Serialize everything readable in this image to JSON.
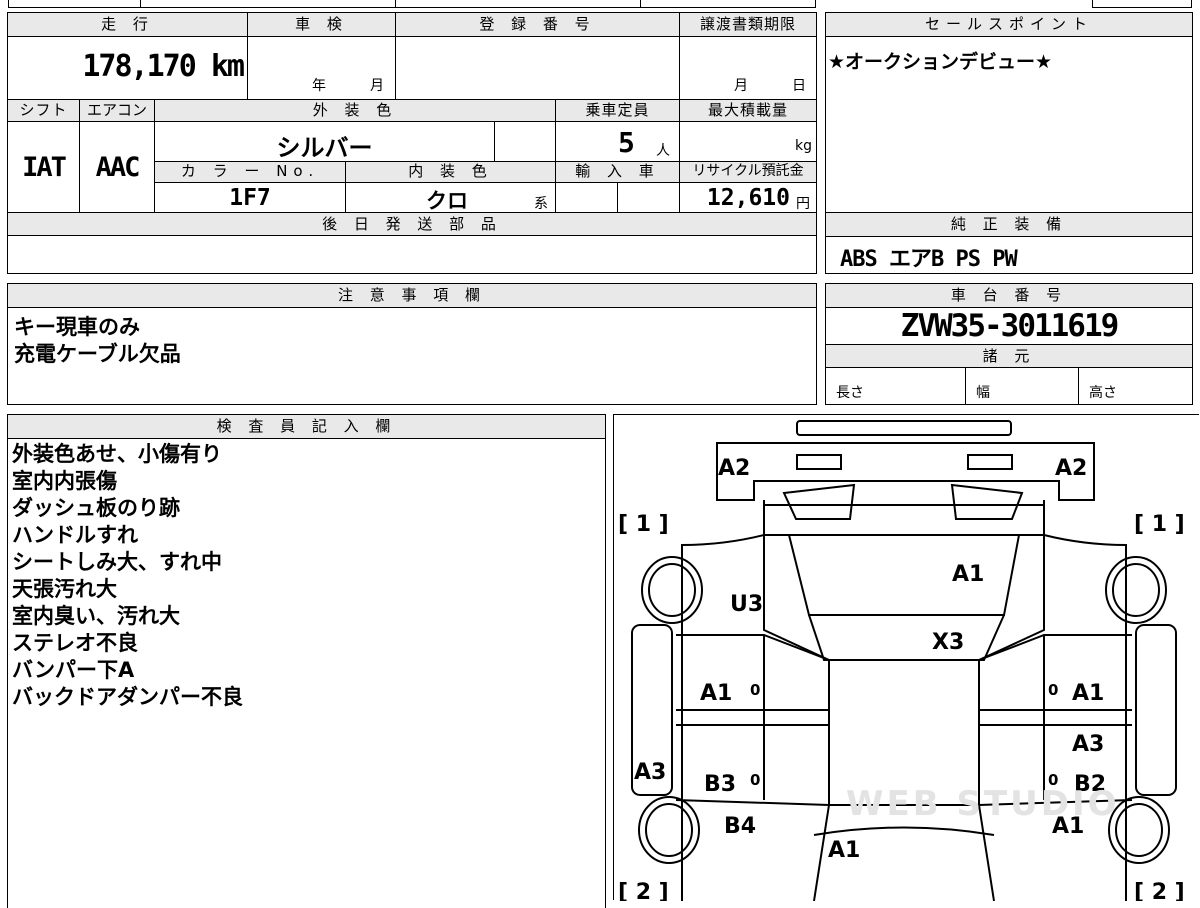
{
  "vehicle": {
    "headers": {
      "mileage": "走 行",
      "inspection": "車 検",
      "registration": "登 録 番 号",
      "transfer_deadline": "譲渡書類期限",
      "shift": "シフト",
      "aircon": "エアコン",
      "exterior_color": "外 装 色",
      "capacity": "乗車定員",
      "max_load": "最大積載量",
      "color_no": "カ ラ ー No.",
      "interior_color": "内 装 色",
      "import": "輸 入 車",
      "recycle_fee": "リサイクル預託金",
      "later_parts": "後 日 発 送 部 品"
    },
    "mileage": "178,170 km",
    "inspection_year_label": "年",
    "inspection_month_label": "月",
    "transfer_month_label": "月",
    "transfer_day_label": "日",
    "shift": "IAT",
    "aircon": "AAC",
    "exterior_color": "シルバー",
    "capacity": "5",
    "capacity_unit": "人",
    "max_load_unit": "kg",
    "color_no": "1F7",
    "interior_color": "クロ",
    "interior_suffix": "系",
    "recycle_fee": "12,610",
    "recycle_unit": "円"
  },
  "sales_points": {
    "header": "セールスポイント",
    "text": "★オークションデビュー★"
  },
  "equipment": {
    "header": "純 正 装 備",
    "text": "ABS エアB PS PW"
  },
  "notes": {
    "header": "注 意 事 項 欄",
    "lines": [
      "キー現車のみ",
      "充電ケーブル欠品"
    ]
  },
  "chassis": {
    "header": "車 台 番 号",
    "number": "ZVW35-3011619",
    "specs_header": "諸 元",
    "length_label": "長さ",
    "width_label": "幅",
    "height_label": "高さ"
  },
  "inspector": {
    "header": "検 査 員 記 入 欄",
    "lines": [
      "外装色あせ、小傷有り",
      "室内内張傷",
      "ダッシュ板のり跡",
      "ハンドルすれ",
      "シートしみ大、すれ中",
      "天張汚れ大",
      "室内臭い、汚れ大",
      "ステレオ不良",
      "バンパー下A",
      "バックドアダンパー不良"
    ]
  },
  "diagram": {
    "labels": {
      "a2_left": "A2",
      "a2_right": "A2",
      "bracket_1_left": "[ 1 ]",
      "bracket_1_right": "[ 1 ]",
      "bracket_2_left": "[ 2 ]",
      "bracket_2_right": "[ 2 ]",
      "u3": "U3",
      "a1_roof": "A1",
      "x3": "X3",
      "a1_front_left_door": "A1",
      "a1_front_right_door": "A1",
      "zero_1": "0",
      "zero_2": "0",
      "zero_3": "0",
      "zero_4": "0",
      "a3_left": "A3",
      "a3_right": "A3",
      "b3": "B3",
      "b2": "B2",
      "b4": "B4",
      "a1_rear_right": "A1",
      "a1_back": "A1"
    },
    "watermark": "WEB STUDIO"
  }
}
